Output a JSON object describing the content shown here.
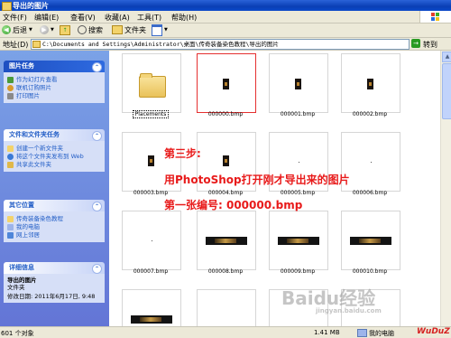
{
  "window": {
    "title": "导出的图片"
  },
  "menu": [
    "文件(F)",
    "编辑(E)",
    "查看(V)",
    "收藏(A)",
    "工具(T)",
    "帮助(H)"
  ],
  "toolbar": {
    "back": "后退",
    "search": "搜索",
    "folders": "文件夹"
  },
  "address": {
    "label": "地址(D)",
    "path": "C:\\Documents and Settings\\Administrator\\桌面\\传奇装备染色教程\\导出的图片",
    "go": "转到"
  },
  "left": {
    "picture_tasks": {
      "title": "图片任务",
      "items": [
        "作为幻灯片查看",
        "联机订购照片",
        "打印图片"
      ]
    },
    "file_tasks": {
      "title": "文件和文件夹任务",
      "items": [
        "创建一个新文件夹",
        "将这个文件夹发布到 Web",
        "共享此文件夹"
      ]
    },
    "other_places": {
      "title": "其它位置",
      "items": [
        "传奇装备染色教程",
        "我的电脑",
        "网上邻居"
      ]
    },
    "details": {
      "title": "详细信息",
      "name": "导出的图片",
      "type": "文件夹",
      "modified": "修改日期: 2011年6月17日, 9:48"
    }
  },
  "files": [
    "Placements",
    "000000.bmp",
    "000001.bmp",
    "000002.bmp",
    "000003.bmp",
    "000004.bmp",
    "000005.bmp",
    "000006.bmp",
    "000007.bmp",
    "000008.bmp",
    "000009.bmp",
    "000010.bmp"
  ],
  "overlay": {
    "line1": "第三步:",
    "line2": "用PhotoShop打开刚才导出来的图片",
    "line3": "第一张编号: 000000.bmp"
  },
  "status": {
    "objects": "601 个对象",
    "size": "1.41 MB",
    "location": "我的电脑"
  },
  "watermark": {
    "brand": "Baidu经验",
    "url": "jingyan.baidu.com",
    "logo": "WuDuZ"
  },
  "colors": {
    "overlay_red": "#e81a1a",
    "xp_blue": "#0a3fb5"
  }
}
